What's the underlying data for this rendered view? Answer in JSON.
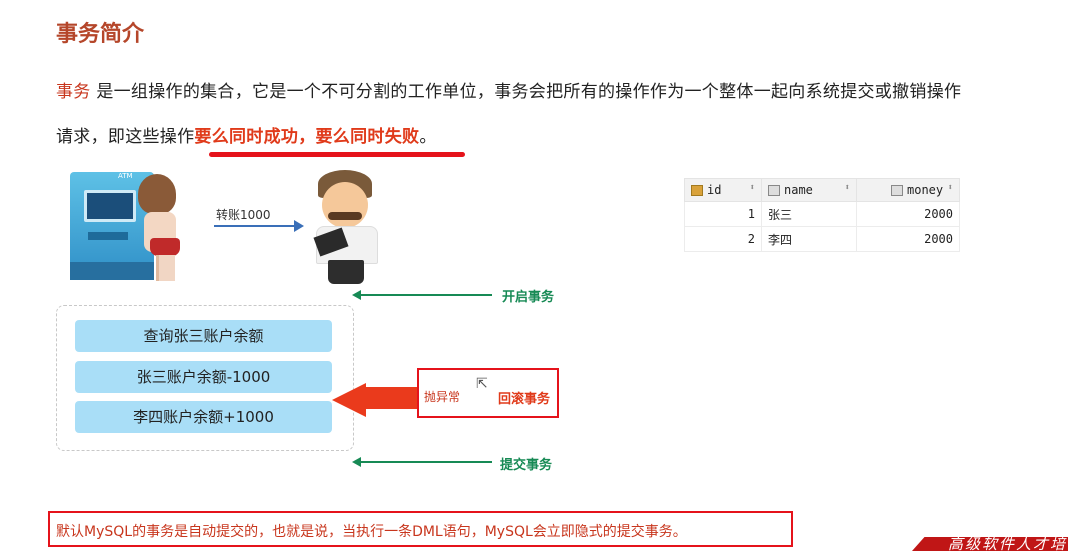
{
  "title": "事务简介",
  "paragraph": {
    "term": "事务",
    "line1_rest": " 是一组操作的集合，它是一个不可分割的工作单位，事务会把所有的操作作为一个整体一起向系统提交或撤销操作",
    "line2_prefix": "请求，即这些操作",
    "line2_highlight": "要么同时成功，要么同时失败",
    "line2_suffix": "。"
  },
  "diagram": {
    "atm_label": "ATM",
    "transfer_label": "转账1000",
    "begin_label": "开启事务",
    "operations": [
      "查询张三账户余额",
      "张三账户余额-1000",
      "李四账户余额+1000"
    ],
    "throw_label": "抛异常",
    "rollback_label": "回滚事务",
    "commit_label": "提交事务"
  },
  "table": {
    "columns": [
      "id",
      "name",
      "money"
    ],
    "rows": [
      {
        "id": "1",
        "name": "张三",
        "money": "2000"
      },
      {
        "id": "2",
        "name": "李四",
        "money": "2000"
      }
    ]
  },
  "note": "默认MySQL的事务是自动提交的，也就是说，当执行一条DML语句，MySQL会立即隐式的提交事务。",
  "corner_text": "高级软件人才培"
}
